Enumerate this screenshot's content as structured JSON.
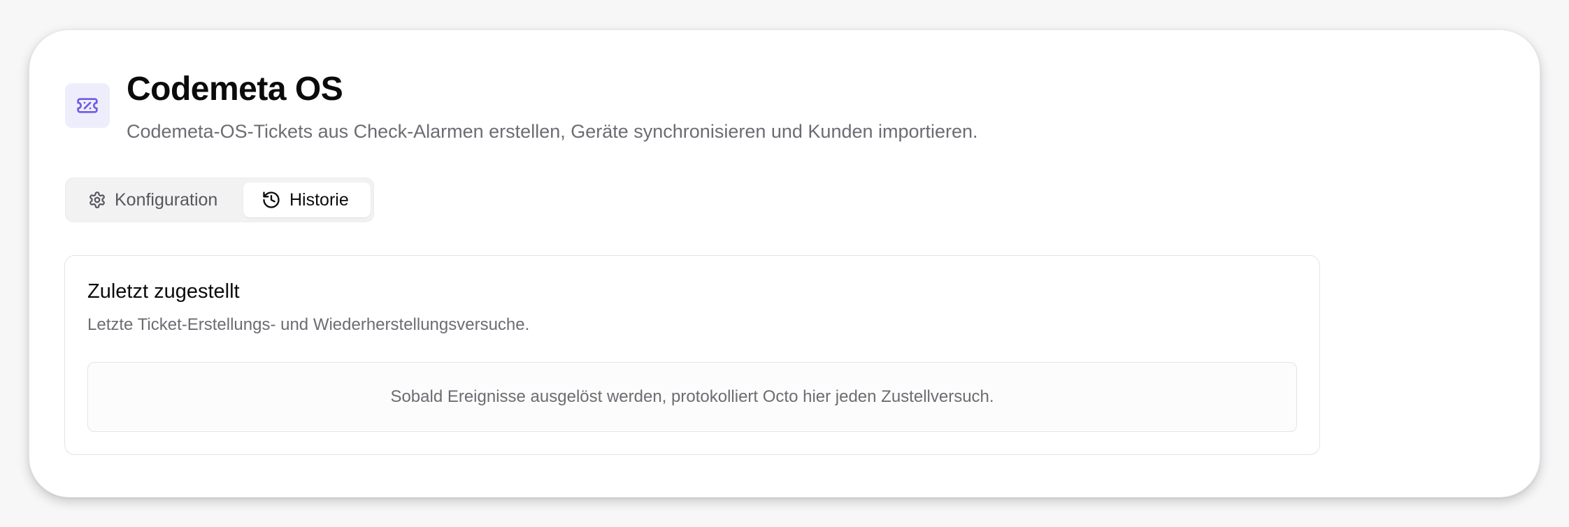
{
  "header": {
    "icon": "ticket-icon",
    "title": "Codemeta OS",
    "subtitle": "Codemeta-OS-Tickets aus Check-Alarmen erstellen, Geräte synchronisieren und Kunden importieren."
  },
  "tabs": [
    {
      "label": "Konfiguration",
      "icon": "gear-icon",
      "active": false
    },
    {
      "label": "Historie",
      "icon": "history-icon",
      "active": true
    }
  ],
  "panel": {
    "title": "Zuletzt zugestellt",
    "description": "Letzte Ticket-Erstellungs- und Wiederherstellungsversuche.",
    "empty_message": "Sobald Ereignisse ausgelöst werden, protokolliert Octo hier jeden Zustellversuch."
  },
  "colors": {
    "accent": "#6b5ce7",
    "icon_bg": "#eeedfb",
    "text_primary": "#0b0b0c",
    "text_muted": "#6c6c72"
  }
}
